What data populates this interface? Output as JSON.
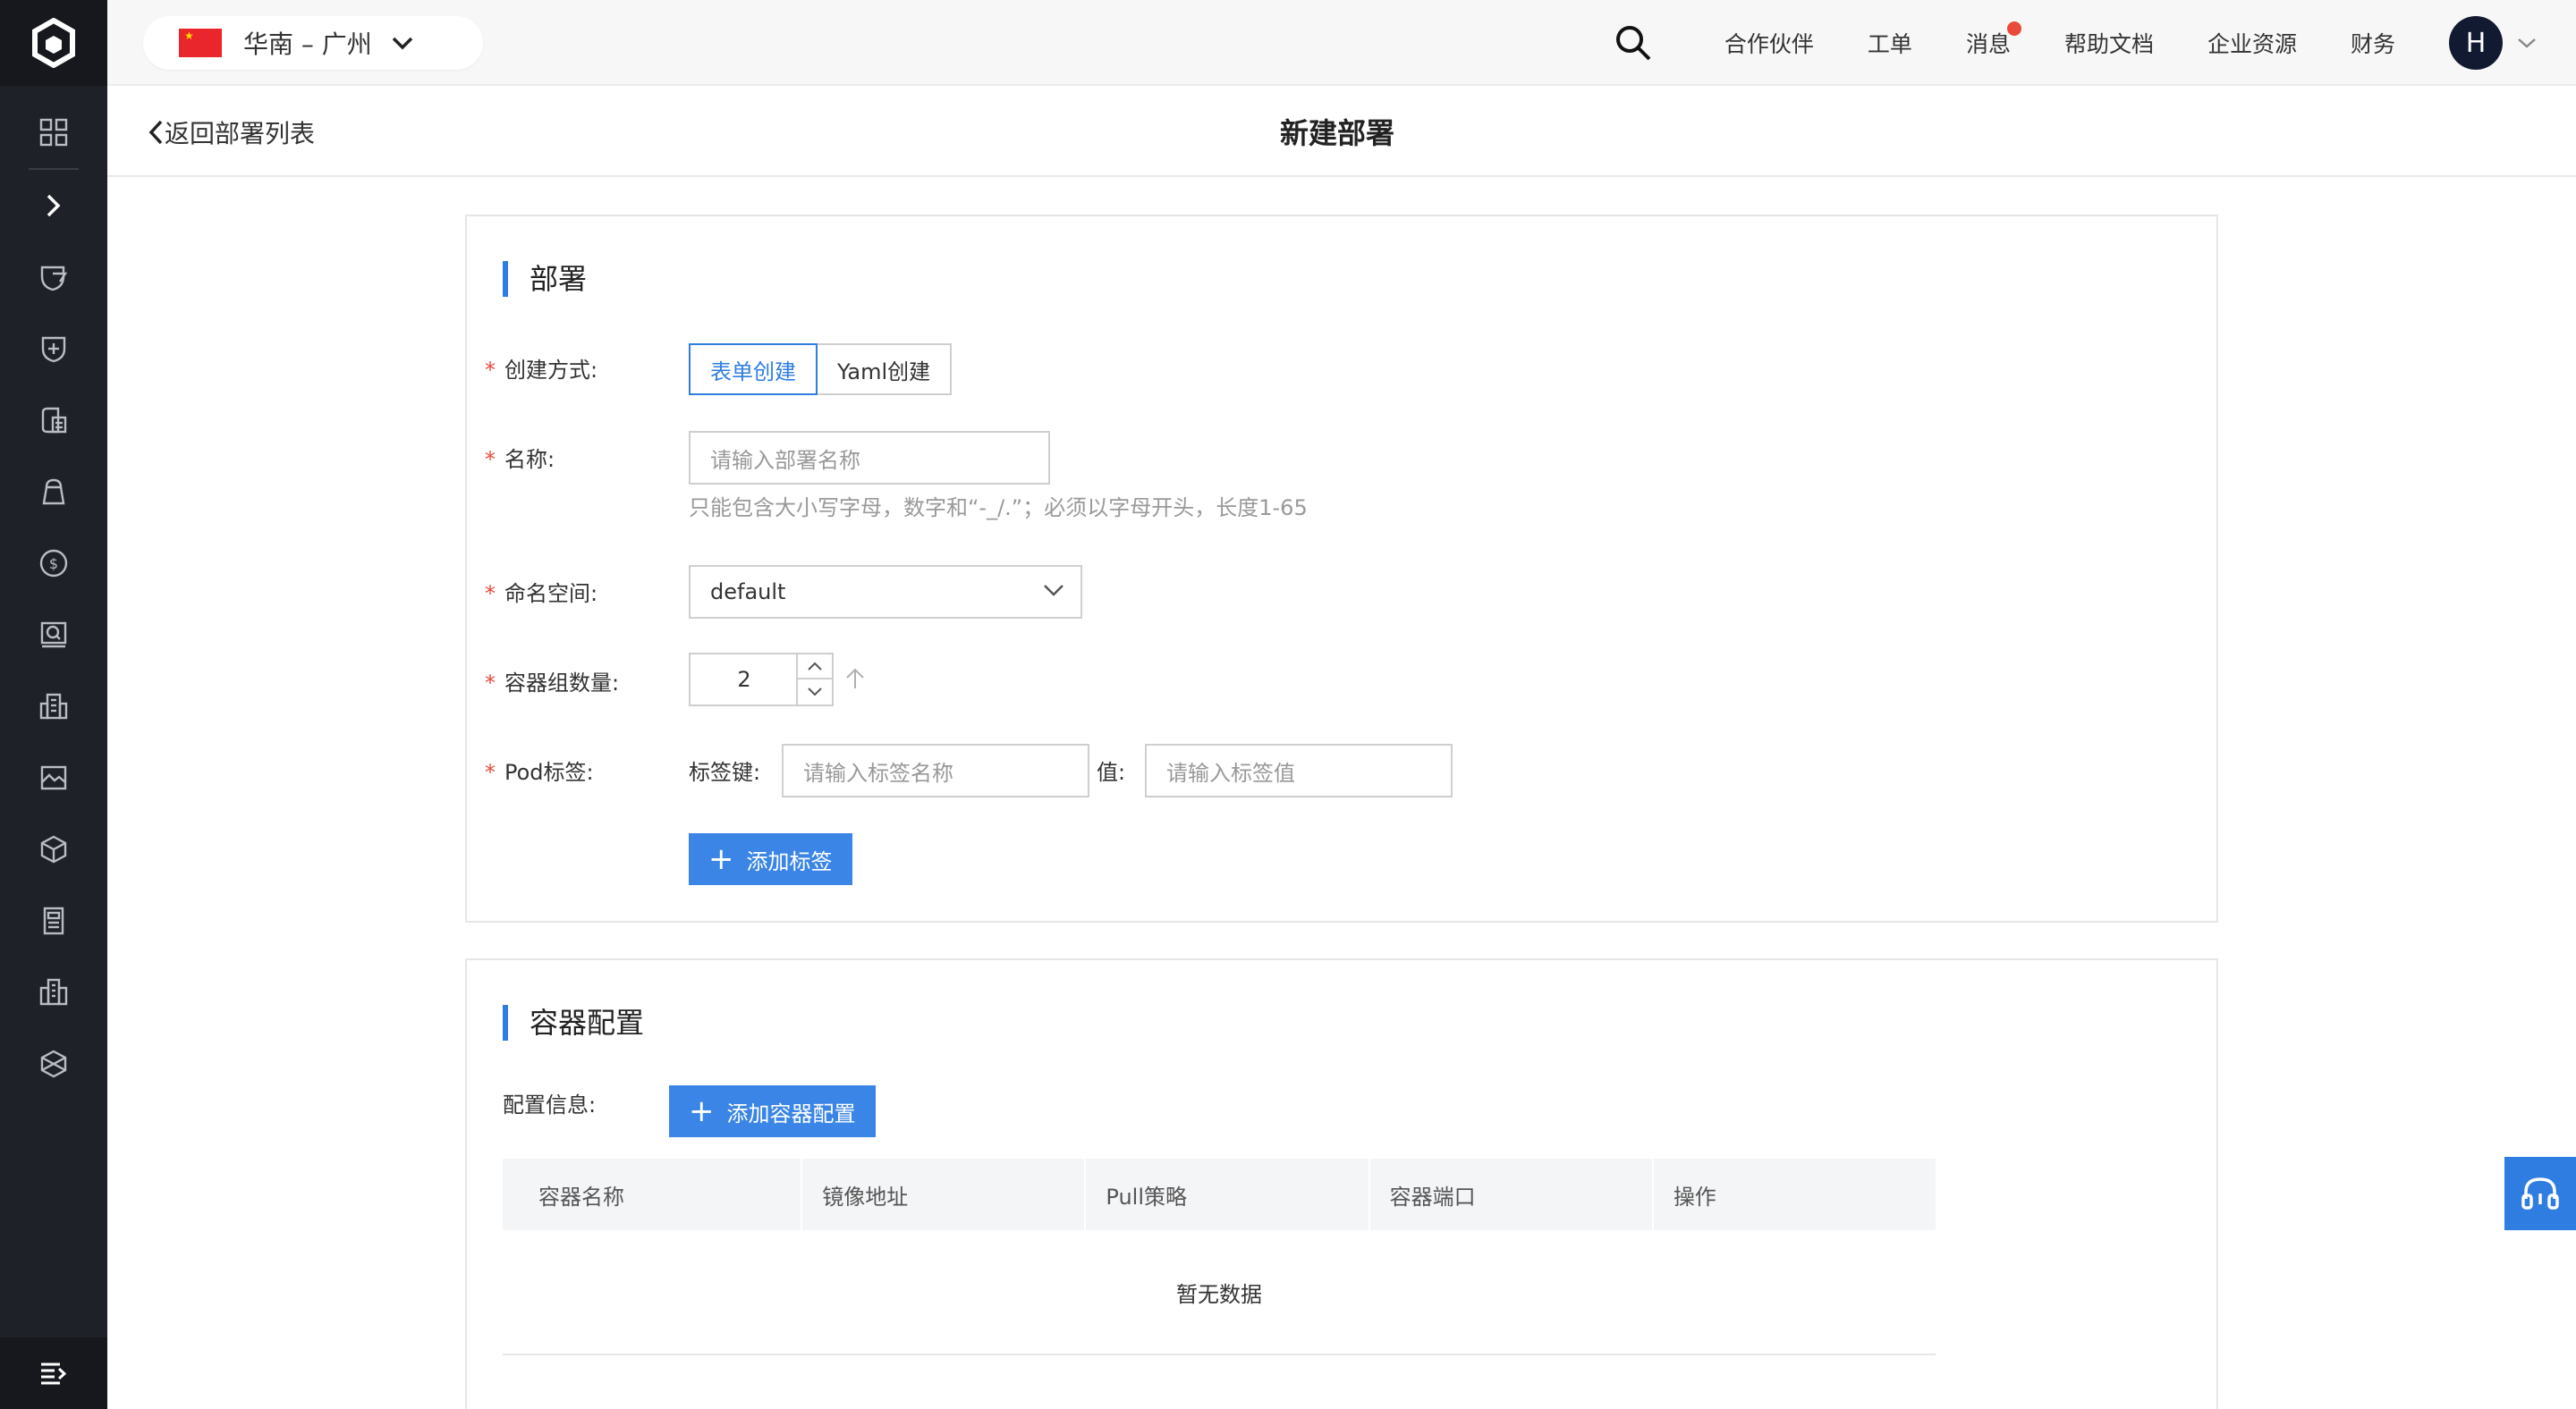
{
  "header": {
    "region": "华南 – 广州",
    "nav": [
      "合作伙伴",
      "工单",
      "消息",
      "帮助文档",
      "企业资源",
      "财务"
    ],
    "avatar_letter": "H"
  },
  "subheader": {
    "back_label": "返回部署列表",
    "title": "新建部署"
  },
  "deploy": {
    "section_title": "部署",
    "create_method_label": "创建方式:",
    "methods": [
      "表单创建",
      "Yaml创建"
    ],
    "name_label": "名称:",
    "name_placeholder": "请输入部署名称",
    "name_hint": "只能包含大小写字母，数字和“-_/.”；必须以字母开头，长度1-65",
    "namespace_label": "命名空间:",
    "namespace_value": "default",
    "replicas_label": "容器组数量:",
    "replicas_value": "2",
    "pod_label": "Pod标签:",
    "tag_key_label": "标签键:",
    "tag_key_placeholder": "请输入标签名称",
    "tag_value_label": "值:",
    "tag_value_placeholder": "请输入标签值",
    "add_tag_label": "添加标签"
  },
  "container": {
    "section_title": "容器配置",
    "config_label": "配置信息:",
    "add_config_label": "添加容器配置",
    "columns": [
      "容器名称",
      "镜像地址",
      "Pull策略",
      "容器端口",
      "操作"
    ],
    "empty_text": "暂无数据"
  }
}
